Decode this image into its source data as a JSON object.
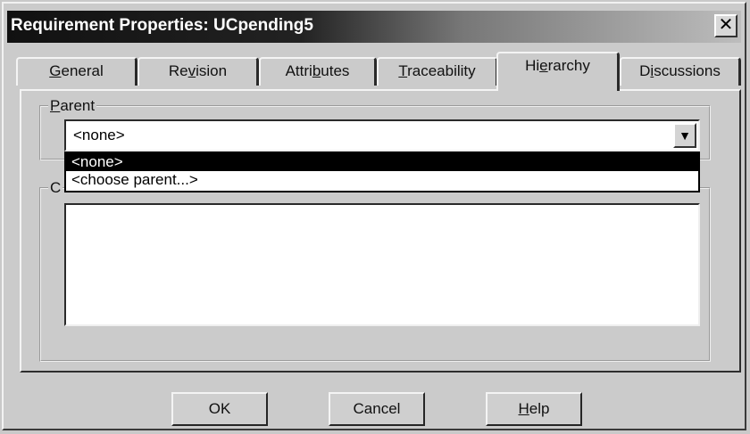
{
  "window": {
    "title": "Requirement Properties: UCpending5",
    "close_glyph": "✕"
  },
  "tabs": [
    {
      "pre": "",
      "acc": "G",
      "post": "eneral"
    },
    {
      "pre": "Re",
      "acc": "v",
      "post": "ision"
    },
    {
      "pre": "Attri",
      "acc": "b",
      "post": "utes"
    },
    {
      "pre": "",
      "acc": "T",
      "post": "raceability"
    },
    {
      "pre": "Hi",
      "acc": "e",
      "post": "rarchy"
    },
    {
      "pre": "D",
      "acc": "i",
      "post": "scussions"
    }
  ],
  "parent": {
    "label_acc": "P",
    "label_rest": "arent",
    "value": "<none>",
    "options": [
      "<none>",
      "<choose parent...>"
    ],
    "selected_index": 0
  },
  "children": {
    "label_visible": "C"
  },
  "buttons": {
    "ok": "OK",
    "cancel": "Cancel",
    "help_acc": "H",
    "help_rest": "elp"
  },
  "colors": {
    "face": "#cbcbcb",
    "selection": "#000000"
  },
  "icons": {
    "dropdown_arrow": "▼"
  }
}
